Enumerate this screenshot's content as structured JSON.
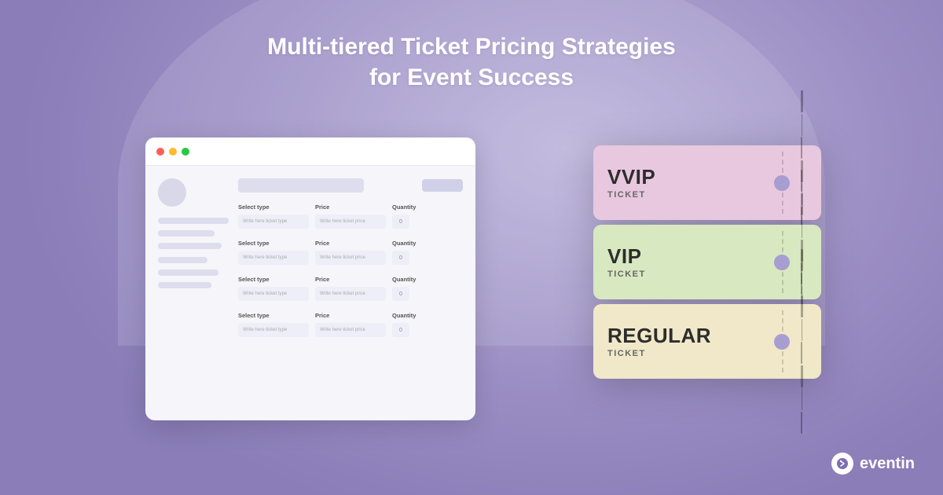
{
  "page": {
    "background_color": "#a89dd0"
  },
  "title": {
    "line1": "Multi-tiered Ticket Pricing Strategies",
    "line2": "for Event Success"
  },
  "browser": {
    "dots": [
      "red",
      "yellow",
      "green"
    ],
    "sidebar_lines": [
      {
        "width": "100%"
      },
      {
        "width": "80%"
      },
      {
        "width": "90%"
      },
      {
        "width": "70%"
      },
      {
        "width": "85%"
      },
      {
        "width": "75%"
      }
    ],
    "ticket_rows": [
      {
        "col1_label": "Select type",
        "col2_label": "Price",
        "col3_label": "Quantity",
        "col1_placeholder": "Write here ticket type",
        "col2_placeholder": "Write here ticket price",
        "col3_value": "0"
      },
      {
        "col1_label": "Select type",
        "col2_label": "Price",
        "col3_label": "Quantity",
        "col1_placeholder": "Write here ticket type",
        "col2_placeholder": "Write here ticket price",
        "col3_value": "0"
      },
      {
        "col1_label": "Select type",
        "col2_label": "Price",
        "col3_label": "Quantity",
        "col1_placeholder": "Write here ticket type",
        "col2_placeholder": "Write here ticket price",
        "col3_value": "0"
      },
      {
        "col1_label": "Select type",
        "col2_label": "Price",
        "col3_label": "Quantity",
        "col1_placeholder": "Write here ticket type",
        "col2_placeholder": "Write here ticket price",
        "col3_value": "0"
      }
    ]
  },
  "tickets": [
    {
      "id": "vvip",
      "name": "VVIP",
      "type_label": "TICKET",
      "color_class": "ticket-vvip"
    },
    {
      "id": "vip",
      "name": "VIP",
      "type_label": "TICKET",
      "color_class": "ticket-vip"
    },
    {
      "id": "regular",
      "name": "REGULAR",
      "type_label": "TICKET",
      "color_class": "ticket-regular"
    }
  ],
  "logo": {
    "icon": "e",
    "text": "eventin"
  }
}
